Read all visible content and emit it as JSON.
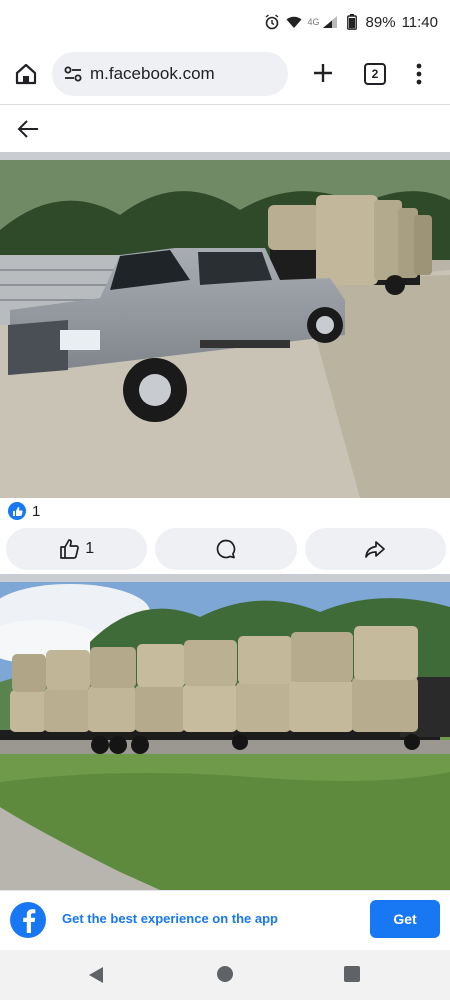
{
  "status_bar": {
    "icons": [
      "alarm-icon",
      "wifi-icon",
      "signal-icon"
    ],
    "network": "4G",
    "battery": "89%",
    "time": "11:40"
  },
  "browser": {
    "url": "m.facebook.com",
    "tab_count": "2",
    "icons": [
      "home-icon",
      "site-settings-icon",
      "new-tab-icon",
      "more-vert-icon"
    ]
  },
  "post": {
    "reaction_count": "1",
    "like_count": "1",
    "actions": [
      "like",
      "comment",
      "share"
    ]
  },
  "app_banner": {
    "text": "Get the best experience on the app",
    "button": "Get"
  },
  "colors": {
    "brand": "#1877f2",
    "pill_bg": "#eef0f4"
  }
}
